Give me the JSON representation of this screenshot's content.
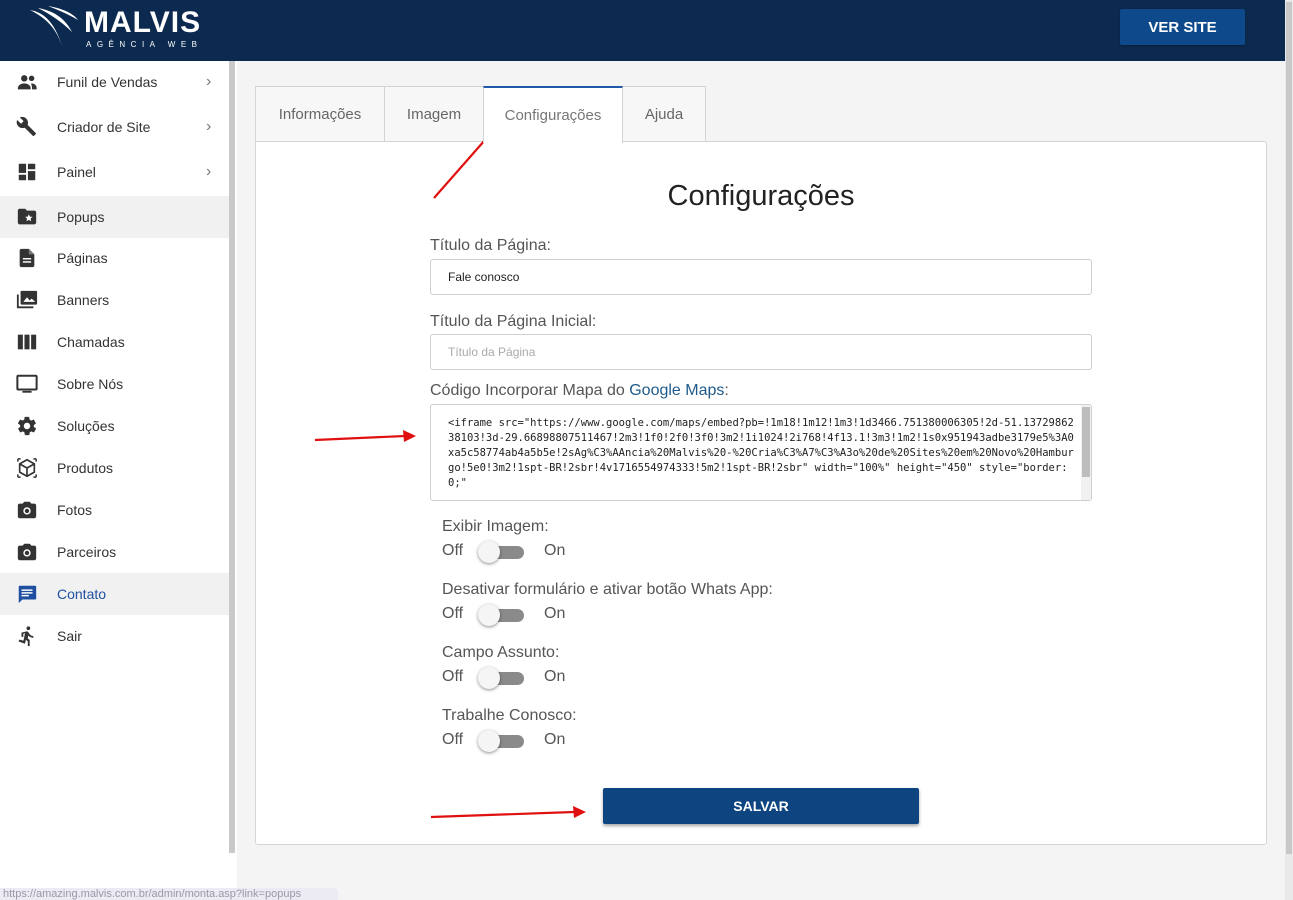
{
  "header": {
    "brand_name": "MALVIS",
    "brand_subtitle": "AGÊNCIA WEB",
    "ver_site_label": "VER SITE"
  },
  "sidebar": {
    "items": [
      {
        "label": "Funil de Vendas",
        "icon": "people-icon",
        "has_submenu": true
      },
      {
        "label": "Criador de Site",
        "icon": "wrench-icon",
        "has_submenu": true
      },
      {
        "label": "Painel",
        "icon": "dashboard-icon",
        "has_submenu": true
      },
      {
        "label": "Popups",
        "icon": "folder-star-icon",
        "has_submenu": false
      },
      {
        "label": "Páginas",
        "icon": "file-icon",
        "has_submenu": false
      },
      {
        "label": "Banners",
        "icon": "images-icon",
        "has_submenu": false
      },
      {
        "label": "Chamadas",
        "icon": "columns-icon",
        "has_submenu": false
      },
      {
        "label": "Sobre Nós",
        "icon": "monitor-icon",
        "has_submenu": false
      },
      {
        "label": "Soluções",
        "icon": "gear-icon",
        "has_submenu": false
      },
      {
        "label": "Produtos",
        "icon": "box-icon",
        "has_submenu": false
      },
      {
        "label": "Fotos",
        "icon": "camera-icon",
        "has_submenu": false
      },
      {
        "label": "Parceiros",
        "icon": "camera-icon",
        "has_submenu": false
      },
      {
        "label": "Contato",
        "icon": "chat-icon",
        "has_submenu": false
      },
      {
        "label": "Sair",
        "icon": "exit-icon",
        "has_submenu": false
      }
    ],
    "chevron": "›"
  },
  "status_url": "https://amazing.malvis.com.br/admin/monta.asp?link=popups",
  "tabs": [
    {
      "label": "Informações"
    },
    {
      "label": "Imagem"
    },
    {
      "label": "Configurações"
    },
    {
      "label": "Ajuda"
    }
  ],
  "form": {
    "title": "Configurações",
    "page_title_label": "Título da Página:",
    "page_title_value": "Fale conosco",
    "home_title_label": "Título da Página Inicial:",
    "home_title_placeholder": "Título da Página",
    "maps_label_prefix": "Código Incorporar Mapa do ",
    "maps_label_link": "Google Maps",
    "maps_label_suffix": ":",
    "maps_code": "<iframe src=\"https://www.google.com/maps/embed?pb=!1m18!1m12!1m3!1d3466.751380006305!2d-51.1372986238103!3d-29.66898807511467!2m3!1f0!2f0!3f0!3m2!1i1024!2i768!4f13.1!3m3!1m2!1s0x951943adbe3179e5%3A0xa5c58774ab4a5b5e!2sAg%C3%AAncia%20Malvis%20-%20Cria%C3%A7%C3%A3o%20de%20Sites%20em%20Novo%20Hamburgo!5e0!3m2!1spt-BR!2sbr!4v1716554974333!5m2!1spt-BR!2sbr\" width=\"100%\" height=\"450\" style=\"border:0;\"",
    "toggles": [
      {
        "label": "Exibir Imagem:",
        "off": "Off",
        "on": "On",
        "state": "off"
      },
      {
        "label": "Desativar formulário e ativar botão Whats App:",
        "off": "Off",
        "on": "On",
        "state": "off"
      },
      {
        "label": "Campo Assunto:",
        "off": "Off",
        "on": "On",
        "state": "off"
      },
      {
        "label": "Trabalhe Conosco:",
        "off": "Off",
        "on": "On",
        "state": "off"
      }
    ],
    "save_label": "SALVAR"
  },
  "colors": {
    "header_bg": "#0c2a4f",
    "button_blue": "#0e4580",
    "active_link": "#1f4fa0",
    "annotation_arrow": "#e01010"
  }
}
